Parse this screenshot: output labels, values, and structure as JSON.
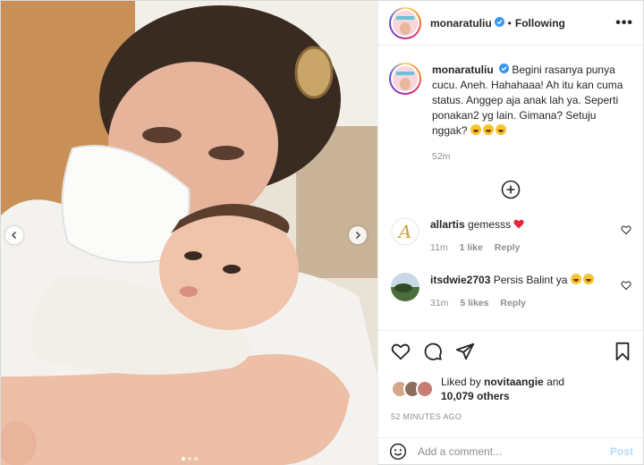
{
  "post_author": {
    "username": "monaratuliu",
    "verified": true,
    "follow_status": "Following",
    "separator": "•"
  },
  "header": {
    "more_label": "•••"
  },
  "caption": {
    "username": "monaratuliu",
    "text": "Begini rasanya punya cucu. Aneh. Hahahaaa! Ah itu kan cuma status. Anggep aja anak lah ya. Seperti ponakan2 yg lain. Gimana? Setuju nggak?",
    "emoji_count": 3,
    "time": "52m"
  },
  "comments": [
    {
      "username": "allartis",
      "text": "gemesss",
      "emoji": "red-heart",
      "time": "11m",
      "likes": "1 like",
      "reply": "Reply"
    },
    {
      "username": "itsdwie2703",
      "text": "Persis Balint ya",
      "emoji": "heart-eyes",
      "time": "31m",
      "likes": "5 likes",
      "reply": "Reply"
    }
  ],
  "likes": {
    "prefix": "Liked by",
    "user": "novitaangie",
    "joiner": "and",
    "others": "10,079 others"
  },
  "time_ago": "52 MINUTES AGO",
  "add_comment": {
    "placeholder": "Add a comment...",
    "post_label": "Post"
  },
  "carousel": {
    "total": 3,
    "active_index": 0
  },
  "colors": {
    "accent_blue": "#0095f6",
    "muted": "#8e8e8e",
    "post_disabled": "#b2dffc",
    "heart_red": "#ed4956"
  }
}
